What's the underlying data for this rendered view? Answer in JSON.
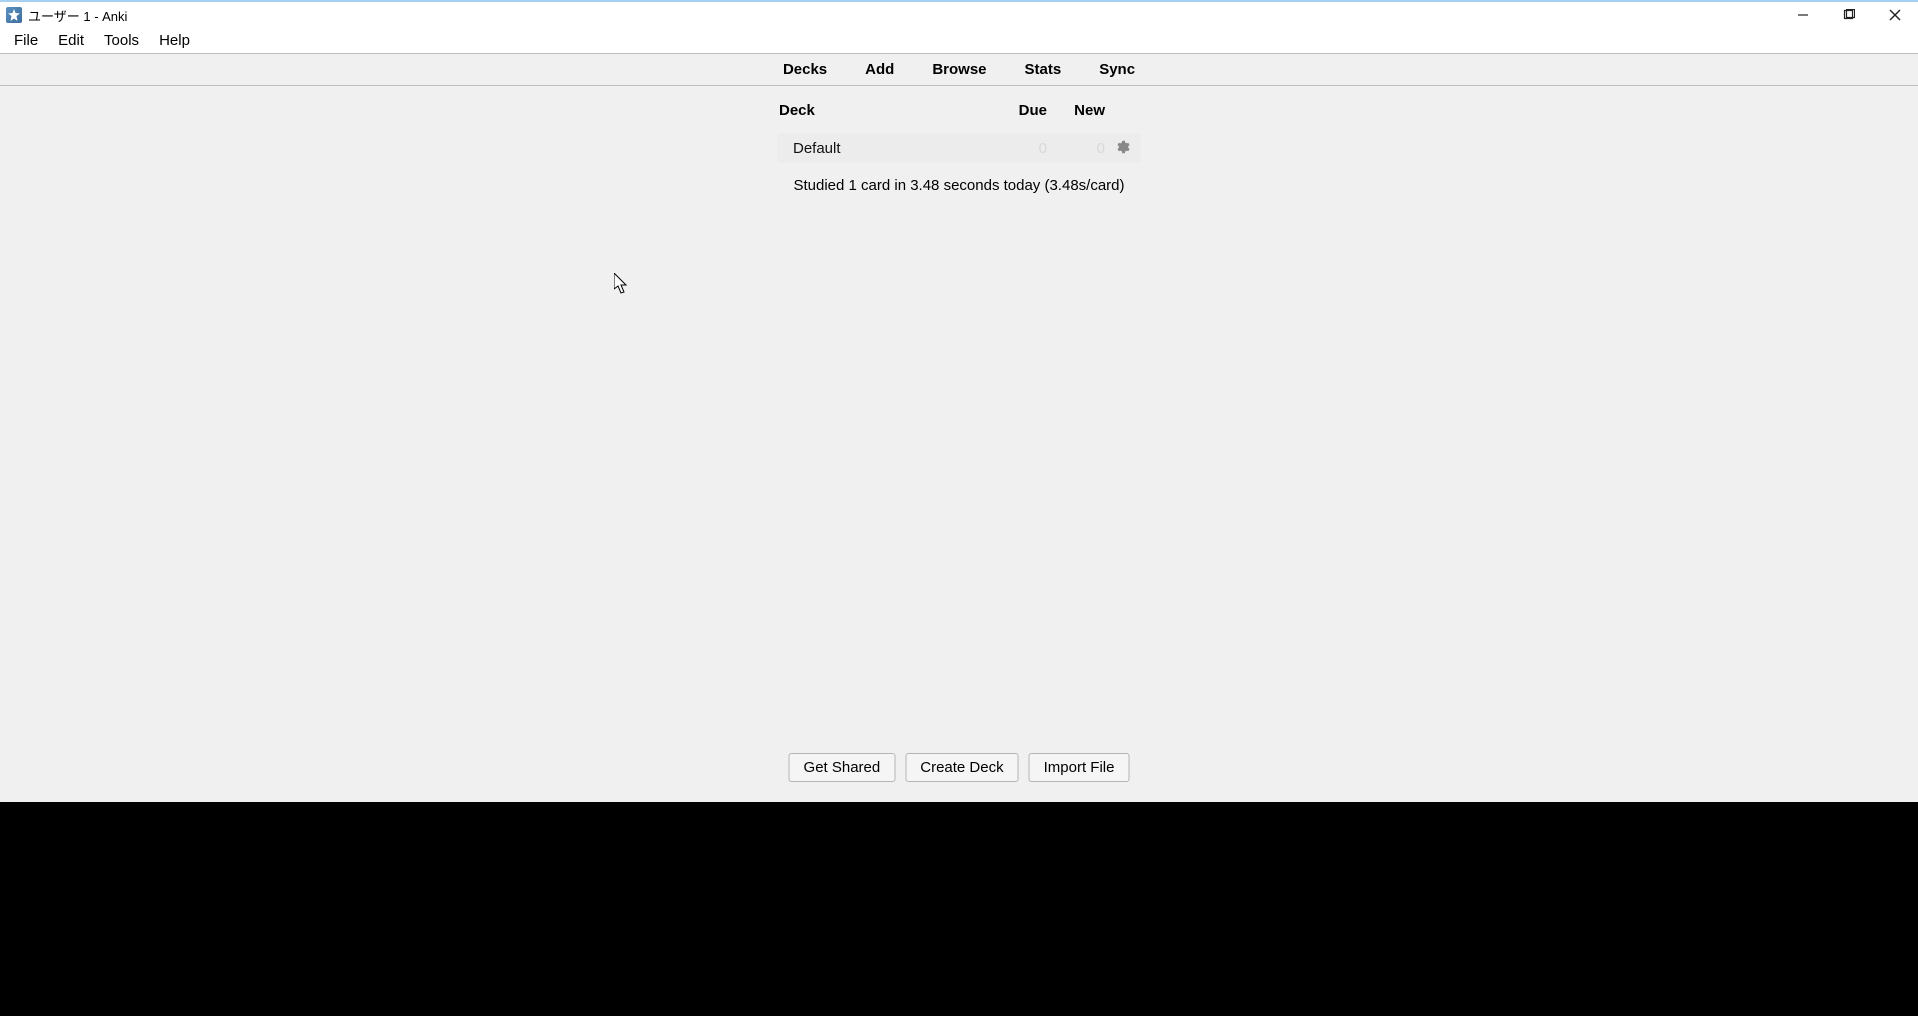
{
  "window": {
    "title": "ユーザー 1 - Anki"
  },
  "menubar": {
    "file": "File",
    "edit": "Edit",
    "tools": "Tools",
    "help": "Help"
  },
  "navtabs": {
    "decks": "Decks",
    "add": "Add",
    "browse": "Browse",
    "stats": "Stats",
    "sync": "Sync"
  },
  "deck_table": {
    "headers": {
      "deck": "Deck",
      "due": "Due",
      "new": "New"
    },
    "rows": [
      {
        "name": "Default",
        "due": "0",
        "new": "0"
      }
    ]
  },
  "status_text": "Studied 1 card in 3.48 seconds today (3.48s/card)",
  "bottom_buttons": {
    "get_shared": "Get Shared",
    "create_deck": "Create Deck",
    "import_file": "Import File"
  }
}
